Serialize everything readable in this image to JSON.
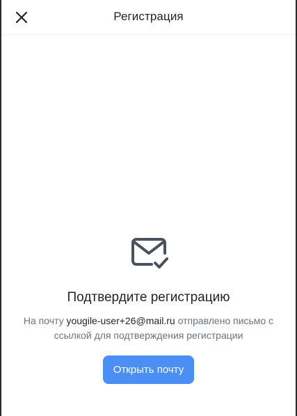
{
  "header": {
    "title": "Регистрация",
    "close_icon": "close-icon"
  },
  "confirmation": {
    "icon": "mail-check-icon",
    "title": "Подтвердите регистрацию",
    "text_before": "На почту ",
    "email": "yougile-user+26@mail.ru",
    "text_after": " отправлено письмо с ссылкой для подтверждения регистрации",
    "button_label": "Открыть почту"
  },
  "colors": {
    "accent": "#4b8ff5",
    "icon": "#4a525e",
    "muted_text": "#6c727d"
  }
}
